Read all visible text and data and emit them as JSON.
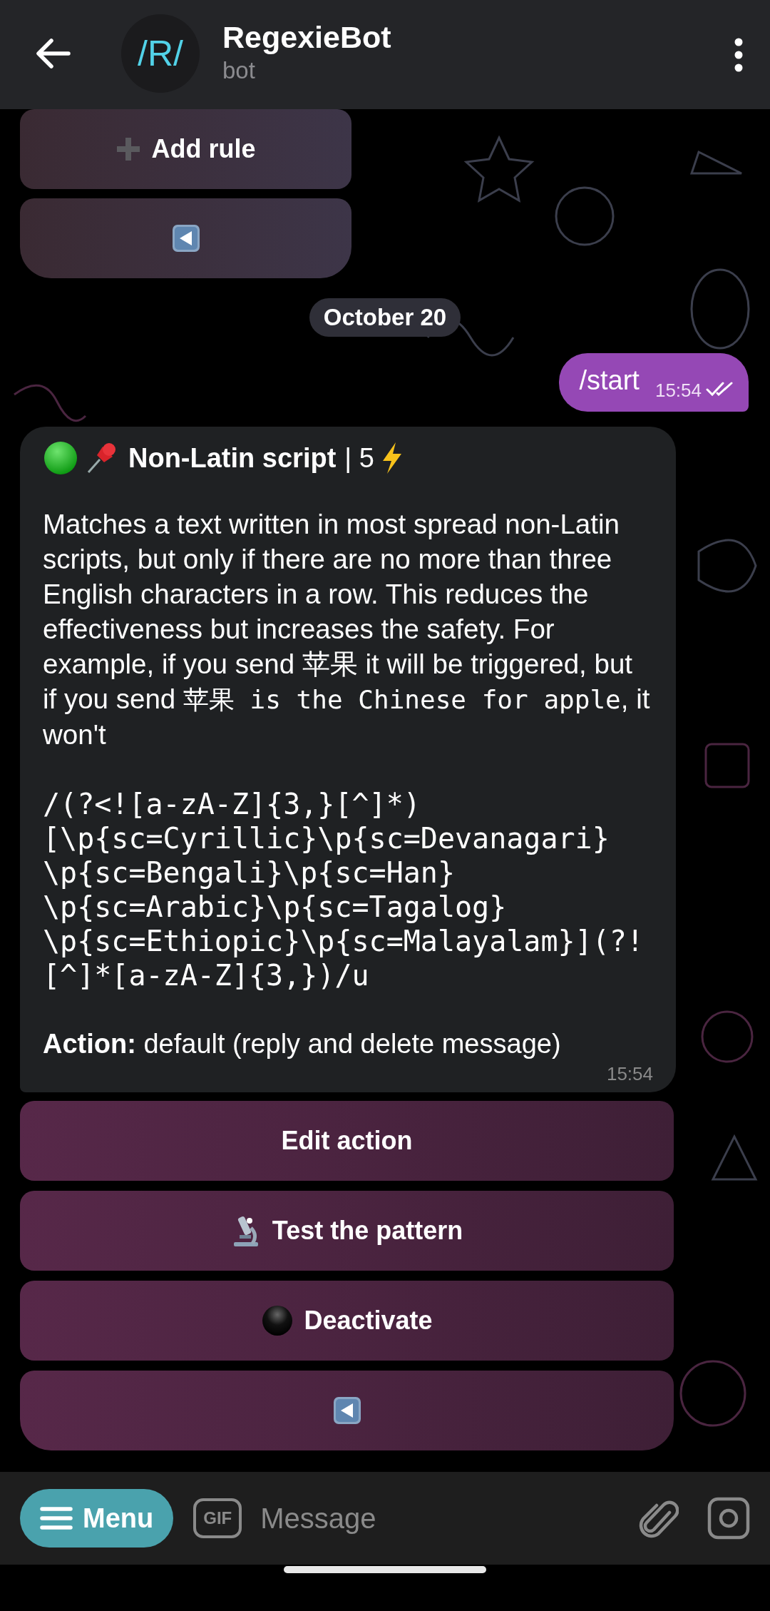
{
  "header": {
    "avatar_text": "/R/",
    "title": "RegexieBot",
    "subtitle": "bot"
  },
  "top_keyboard": [
    {
      "kind": "add",
      "label": "Add rule"
    },
    {
      "kind": "back"
    }
  ],
  "date_badge": "October 20",
  "outgoing": {
    "text": "/start",
    "time": "15:54",
    "read": true
  },
  "rule_message": {
    "active": true,
    "title": "Non-Latin script",
    "title_suffix": "| 5",
    "description": [
      {
        "kind": "plain",
        "text": "Matches a text written in most spread non-Latin scripts, but only if there are no more than three English characters in a row. This reduces the effectiveness but increases the safety. For example, if you send 苹果 it will be triggered, but if you send "
      },
      {
        "kind": "code",
        "text": "苹果 is the Chinese for apple"
      },
      {
        "kind": "plain",
        "text": ", it won't"
      }
    ],
    "pattern": "/(?<![a-zA-Z]{3,}[^]*)[\\p{sc=Cyrillic}\\p{sc=Devanagari}\\p{sc=Bengali}\\p{sc=Han}\\p{sc=Arabic}\\p{sc=Tagalog}\\p{sc=Ethiopic}\\p{sc=Malayalam}](?![^]*[a-zA-Z]{3,})/u",
    "action": "**Action:** default (reply and delete message)",
    "time": "15:54"
  },
  "keyboard": [
    {
      "kind": "text",
      "label": "Edit action"
    },
    {
      "kind": "test",
      "label": "Test the pattern"
    },
    {
      "kind": "deactivate",
      "label": "Deactivate"
    },
    {
      "kind": "back"
    }
  ],
  "composer": {
    "menu_label": "Menu",
    "gif_label": "GIF",
    "placeholder": "Message"
  }
}
